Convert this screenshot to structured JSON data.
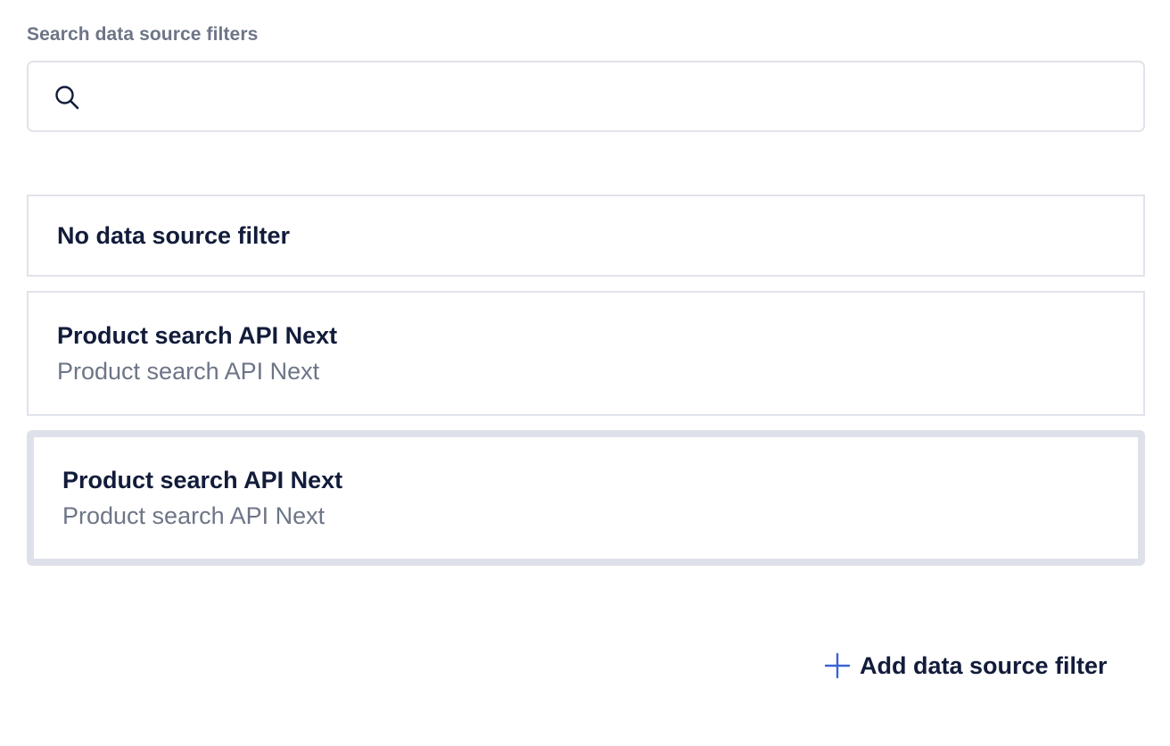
{
  "search": {
    "label": "Search data source filters",
    "value": "",
    "placeholder": "",
    "icon": "search-icon"
  },
  "options": [
    {
      "title": "No data source filter",
      "subtitle": "",
      "selected": false
    },
    {
      "title": "Product search API Next",
      "subtitle": "Product search API Next",
      "selected": false
    },
    {
      "title": "Product search API Next",
      "subtitle": "Product search API Next",
      "selected": true
    }
  ],
  "add_button": {
    "label": "Add data source filter",
    "icon": "plus-icon",
    "icon_color": "#3b63d6"
  },
  "colors": {
    "text_primary": "#121c3a",
    "text_secondary": "#6d7587",
    "border": "#e0e3ea",
    "selected_border": "#dfe1ea",
    "accent": "#3b63d6"
  }
}
